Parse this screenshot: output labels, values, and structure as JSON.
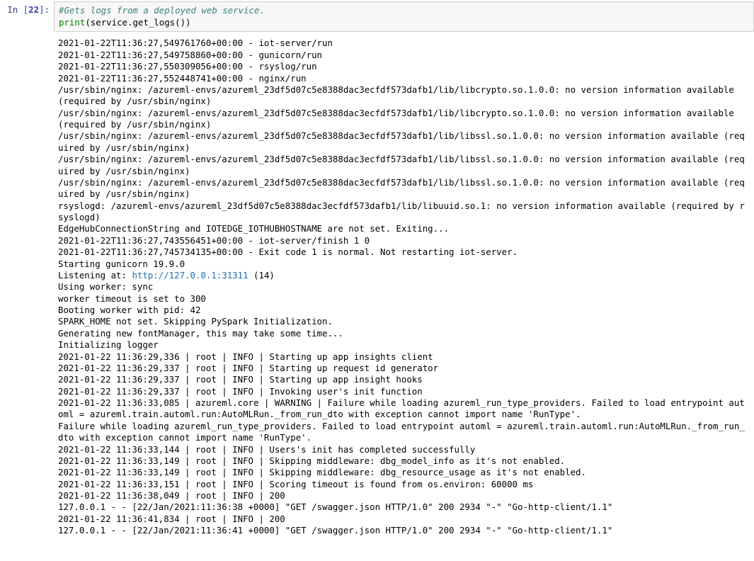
{
  "cell": {
    "prompt_label": "In",
    "prompt_number": "22",
    "code_comment": "#Gets logs from a deployed web service.",
    "code_call_func": "print",
    "code_call_rest": "(service.get_logs())"
  },
  "output": {
    "link_href": "http://127.0.0.1:31311",
    "pre_link": "2021-01-22T11:36:27,549761760+00:00 - iot-server/run\n2021-01-22T11:36:27,549758860+00:00 - gunicorn/run\n2021-01-22T11:36:27,550309056+00:00 - rsyslog/run\n2021-01-22T11:36:27,552448741+00:00 - nginx/run\n/usr/sbin/nginx: /azureml-envs/azureml_23df5d07c5e8388dac3ecfdf573dafb1/lib/libcrypto.so.1.0.0: no version information available (required by /usr/sbin/nginx)\n/usr/sbin/nginx: /azureml-envs/azureml_23df5d07c5e8388dac3ecfdf573dafb1/lib/libcrypto.so.1.0.0: no version information available (required by /usr/sbin/nginx)\n/usr/sbin/nginx: /azureml-envs/azureml_23df5d07c5e8388dac3ecfdf573dafb1/lib/libssl.so.1.0.0: no version information available (required by /usr/sbin/nginx)\n/usr/sbin/nginx: /azureml-envs/azureml_23df5d07c5e8388dac3ecfdf573dafb1/lib/libssl.so.1.0.0: no version information available (required by /usr/sbin/nginx)\n/usr/sbin/nginx: /azureml-envs/azureml_23df5d07c5e8388dac3ecfdf573dafb1/lib/libssl.so.1.0.0: no version information available (required by /usr/sbin/nginx)\nrsyslogd: /azureml-envs/azureml_23df5d07c5e8388dac3ecfdf573dafb1/lib/libuuid.so.1: no version information available (required by rsyslogd)\nEdgeHubConnectionString and IOTEDGE_IOTHUBHOSTNAME are not set. Exiting...\n2021-01-22T11:36:27,743556451+00:00 - iot-server/finish 1 0\n2021-01-22T11:36:27,745734135+00:00 - Exit code 1 is normal. Not restarting iot-server.\nStarting gunicorn 19.9.0\nListening at: ",
    "post_link": " (14)\nUsing worker: sync\nworker timeout is set to 300\nBooting worker with pid: 42\nSPARK_HOME not set. Skipping PySpark Initialization.\nGenerating new fontManager, this may take some time...\nInitializing logger\n2021-01-22 11:36:29,336 | root | INFO | Starting up app insights client\n2021-01-22 11:36:29,337 | root | INFO | Starting up request id generator\n2021-01-22 11:36:29,337 | root | INFO | Starting up app insight hooks\n2021-01-22 11:36:29,337 | root | INFO | Invoking user's init function\n2021-01-22 11:36:33,085 | azureml.core | WARNING | Failure while loading azureml_run_type_providers. Failed to load entrypoint automl = azureml.train.automl.run:AutoMLRun._from_run_dto with exception cannot import name 'RunType'.\nFailure while loading azureml_run_type_providers. Failed to load entrypoint automl = azureml.train.automl.run:AutoMLRun._from_run_dto with exception cannot import name 'RunType'.\n2021-01-22 11:36:33,144 | root | INFO | Users's init has completed successfully\n2021-01-22 11:36:33,149 | root | INFO | Skipping middleware: dbg_model_info as it's not enabled.\n2021-01-22 11:36:33,149 | root | INFO | Skipping middleware: dbg_resource_usage as it's not enabled.\n2021-01-22 11:36:33,151 | root | INFO | Scoring timeout is found from os.environ: 60000 ms\n2021-01-22 11:36:38,049 | root | INFO | 200\n127.0.0.1 - - [22/Jan/2021:11:36:38 +0000] \"GET /swagger.json HTTP/1.0\" 200 2934 \"-\" \"Go-http-client/1.1\"\n2021-01-22 11:36:41,834 | root | INFO | 200\n127.0.0.1 - - [22/Jan/2021:11:36:41 +0000] \"GET /swagger.json HTTP/1.0\" 200 2934 \"-\" \"Go-http-client/1.1\""
  }
}
